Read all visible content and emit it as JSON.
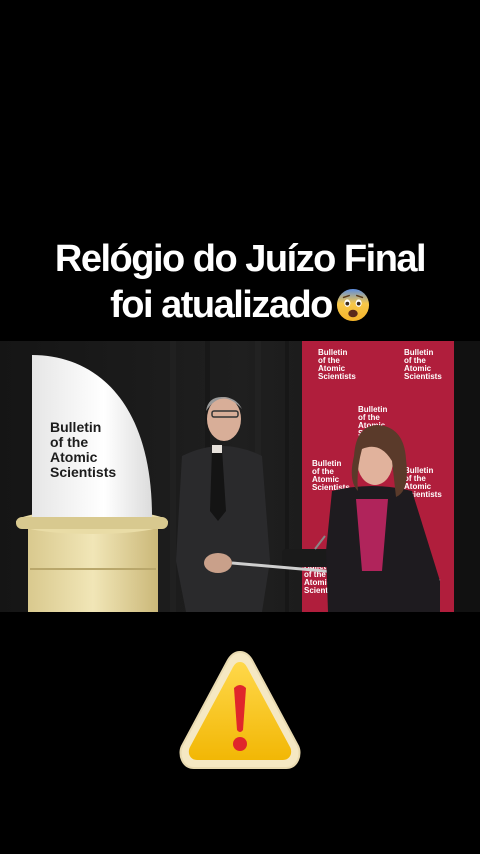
{
  "caption": {
    "line1": "Relógio do Juízo Final",
    "line2": "foi atualizado",
    "emoji": "fearful-face-emoji"
  },
  "video_frame": {
    "clock_sign": [
      "Bulletin",
      "of the",
      "Atomic",
      "Scientists"
    ],
    "backdrop_logo": [
      "Bulletin",
      "of the",
      "Atomic",
      "Scientists"
    ],
    "backdrop_color": "#b01e3c"
  },
  "warning": {
    "icon": "warning-triangle-icon",
    "color": "#f7c21b",
    "mark_color": "#e0262b"
  }
}
